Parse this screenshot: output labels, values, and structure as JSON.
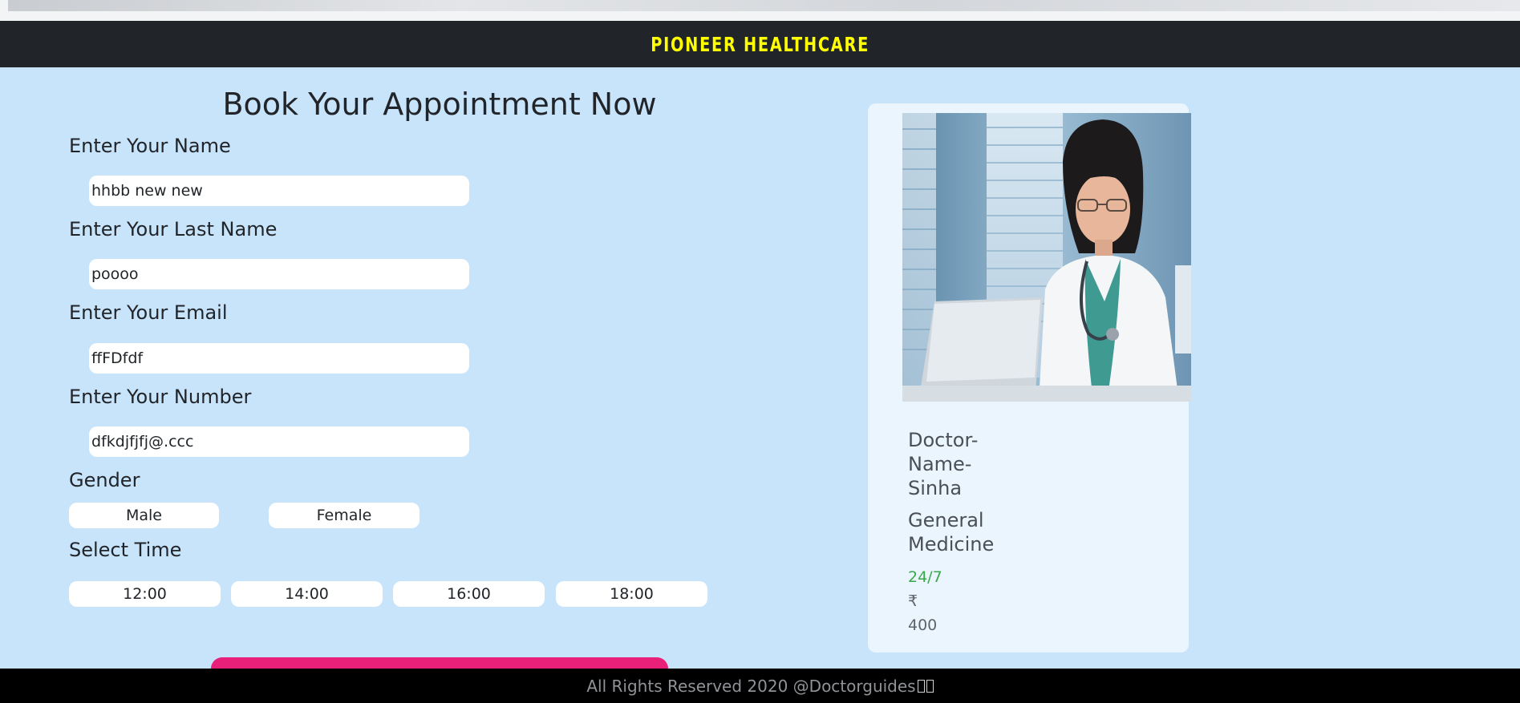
{
  "navbar": {
    "brand": "PIONEER HEALTHCARE"
  },
  "form": {
    "title": "Book Your Appointment Now",
    "name_label": "Enter Your Name",
    "name_value": "hhbb new new",
    "lastname_label": "Enter Your Last Name",
    "lastname_value": "poooo",
    "email_label": "Enter Your Email",
    "email_value": "ffFDfdf",
    "number_label": "Enter Your Number",
    "number_value": "dfkdjfjfj@.ccc",
    "gender_label": "Gender",
    "gender_options": [
      "Male",
      "Female"
    ],
    "time_label": "Select Time",
    "time_options": [
      "12:00",
      "14:00",
      "16:00",
      "18:00"
    ]
  },
  "doctor_card": {
    "name": "Doctor-Name-Sinha",
    "specialty": "General Medicine",
    "availability": "24/7",
    "currency_symbol": "₹",
    "fee": "400"
  },
  "footer": {
    "text": "All Rights Reserved 2020 @Doctorguides"
  },
  "colors": {
    "page_bg": "#c8e4fb",
    "navbar_bg": "#212529",
    "brand": "#ffff00",
    "submit_button": "#e8207a",
    "availability": "#3aa84a",
    "footer_bg": "#000000"
  }
}
